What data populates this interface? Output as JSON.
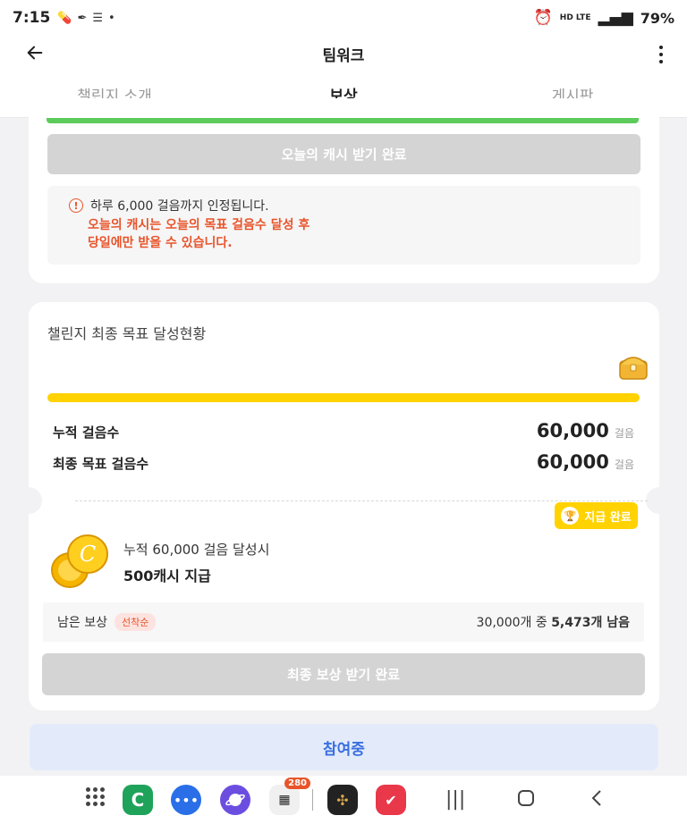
{
  "status_bar": {
    "time": "7:15",
    "network": "HD LTE",
    "voice": "VOICE",
    "battery": "79%"
  },
  "header": {
    "title": "팀워크",
    "back_icon": "arrow-left-icon",
    "more_icon": "kebab-menu-icon"
  },
  "tabs": [
    {
      "label": "챌린지 소개",
      "active": false
    },
    {
      "label": "보상",
      "active": true
    },
    {
      "label": "게시판",
      "active": false
    }
  ],
  "daily": {
    "button_label": "오늘의 캐시 받기 완료",
    "notice": "하루 6,000 걸음까지 인정됩니다.",
    "notice_red_line1": "오늘의 캐시는 오늘의 목표 걸음수 달성 후",
    "notice_red_line2": "당일에만 받을 수 있습니다."
  },
  "final_goal": {
    "heading": "챌린지 최종 목표 달성현황",
    "progress": 1.0,
    "accumulated_label": "누적 걸음수",
    "accumulated_value": "60,000",
    "goal_label": "최종 목표 걸음수",
    "goal_value": "60,000",
    "unit": "걸음",
    "badge_label": "지급 완료",
    "reward_line1": "누적 60,000 걸음 달성시",
    "reward_line2": "500캐시 지급",
    "remain_label": "남은 보상",
    "remain_tag": "선착순",
    "remain_prefix": "30,000개 중",
    "remain_count": "5,473개 남음",
    "button_label": "최종 보상 받기 완료"
  },
  "join_button": "참여중",
  "dock": {
    "badge_count": "280"
  },
  "colors": {
    "accent_yellow": "#ffd200",
    "green": "#5dcb5b",
    "warning_red": "#e8542a",
    "join_blue": "#3a6fe0"
  }
}
